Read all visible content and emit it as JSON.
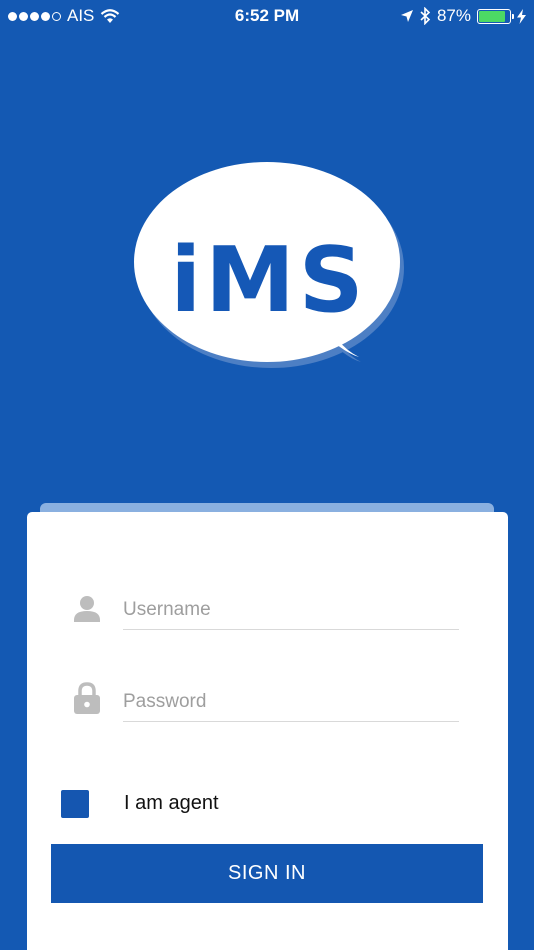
{
  "status_bar": {
    "carrier": "AIS",
    "time": "6:52 PM",
    "battery_percent": "87%",
    "battery_level": 0.87
  },
  "app": {
    "logo_text": "iMS"
  },
  "login": {
    "username_placeholder": "Username",
    "password_placeholder": "Password",
    "agent_label": "I am agent",
    "signin_label": "SIGN IN"
  },
  "colors": {
    "primary": "#1459b3",
    "battery": "#4cd964"
  },
  "icons": [
    "wifi-icon",
    "location-arrow-icon",
    "bluetooth-icon",
    "battery-icon",
    "charging-icon",
    "user-icon",
    "lock-icon"
  ]
}
